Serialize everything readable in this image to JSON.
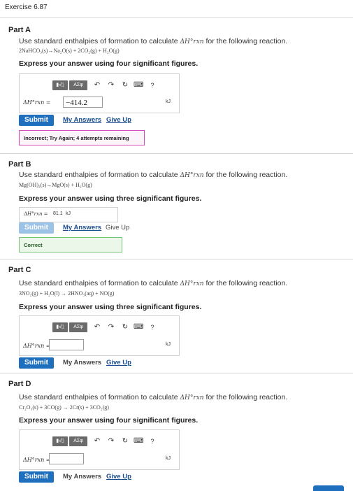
{
  "exercise": {
    "title": "Exercise 6.87"
  },
  "colors": {
    "accent": "#1f6fbf",
    "incorrect_border": "#d44bb4",
    "correct_border": "#76c47a"
  },
  "toolbar": {
    "template_label": "▮√▯",
    "symbols_label": "ΑΣφ",
    "undo_icon": "undo-icon",
    "redo_icon": "redo-icon",
    "reset_icon": "reset-icon",
    "keyboard_icon": "keyboard-icon",
    "help_label": "?"
  },
  "parts": [
    {
      "title": "Part A",
      "instruction_pre": "Use standard enthalpies of formation to calculate ",
      "instruction_symbol": "ΔH°rxn",
      "instruction_post": " for the following reaction.",
      "reaction": "2NaHCO₃(s)→Na₂O(s) + 2CO₂(g) + H₂O(g)",
      "express": "Express your answer using four significant figures.",
      "dh_label": "ΔH°rxn =",
      "answer_value": "−414.2",
      "unit": "kJ",
      "submit_label": "Submit",
      "my_answers_label": "My Answers",
      "give_up_label": "Give Up",
      "feedback": "Incorrect; Try Again; 4 attempts remaining"
    },
    {
      "title": "Part B",
      "instruction_pre": "Use standard enthalpies of formation to calculate ",
      "instruction_symbol": "ΔH°rxn",
      "instruction_post": " for the following reaction.",
      "reaction": "Mg(OH)₂(s)→MgO(s) + H₂O(g)",
      "express": "Express your answer using three significant figures.",
      "dh_label": "ΔH°rxn =",
      "answer_value": "81.1",
      "unit": "kJ",
      "submit_label": "Submit",
      "my_answers_label": "My Answers",
      "give_up_label": "Give Up",
      "feedback": "Correct"
    },
    {
      "title": "Part C",
      "instruction_pre": "Use standard enthalpies of formation to calculate ",
      "instruction_symbol": "ΔH°rxn",
      "instruction_post": " for the following reaction.",
      "reaction": "3NO₂(g) + H₂O(l) → 2HNO₃(aq) + NO(g)",
      "express": "Express your answer using three significant figures.",
      "dh_label": "ΔH°rxn =",
      "answer_value": "",
      "unit": "kJ",
      "submit_label": "Submit",
      "my_answers_label": "My Answers",
      "give_up_label": "Give Up"
    },
    {
      "title": "Part D",
      "instruction_pre": "Use standard enthalpies of formation to calculate ",
      "instruction_symbol": "ΔH°rxn",
      "instruction_post": " for the following reaction.",
      "reaction": "Cr₂O₃(s) + 3CO(g) → 2Cr(s) + 3CO₂(g)",
      "express": "Express your answer using four significant figures.",
      "dh_label": "ΔH°rxn =",
      "answer_value": "",
      "unit": "kJ",
      "submit_label": "Submit",
      "my_answers_label": "My Answers",
      "give_up_label": "Give Up"
    }
  ]
}
